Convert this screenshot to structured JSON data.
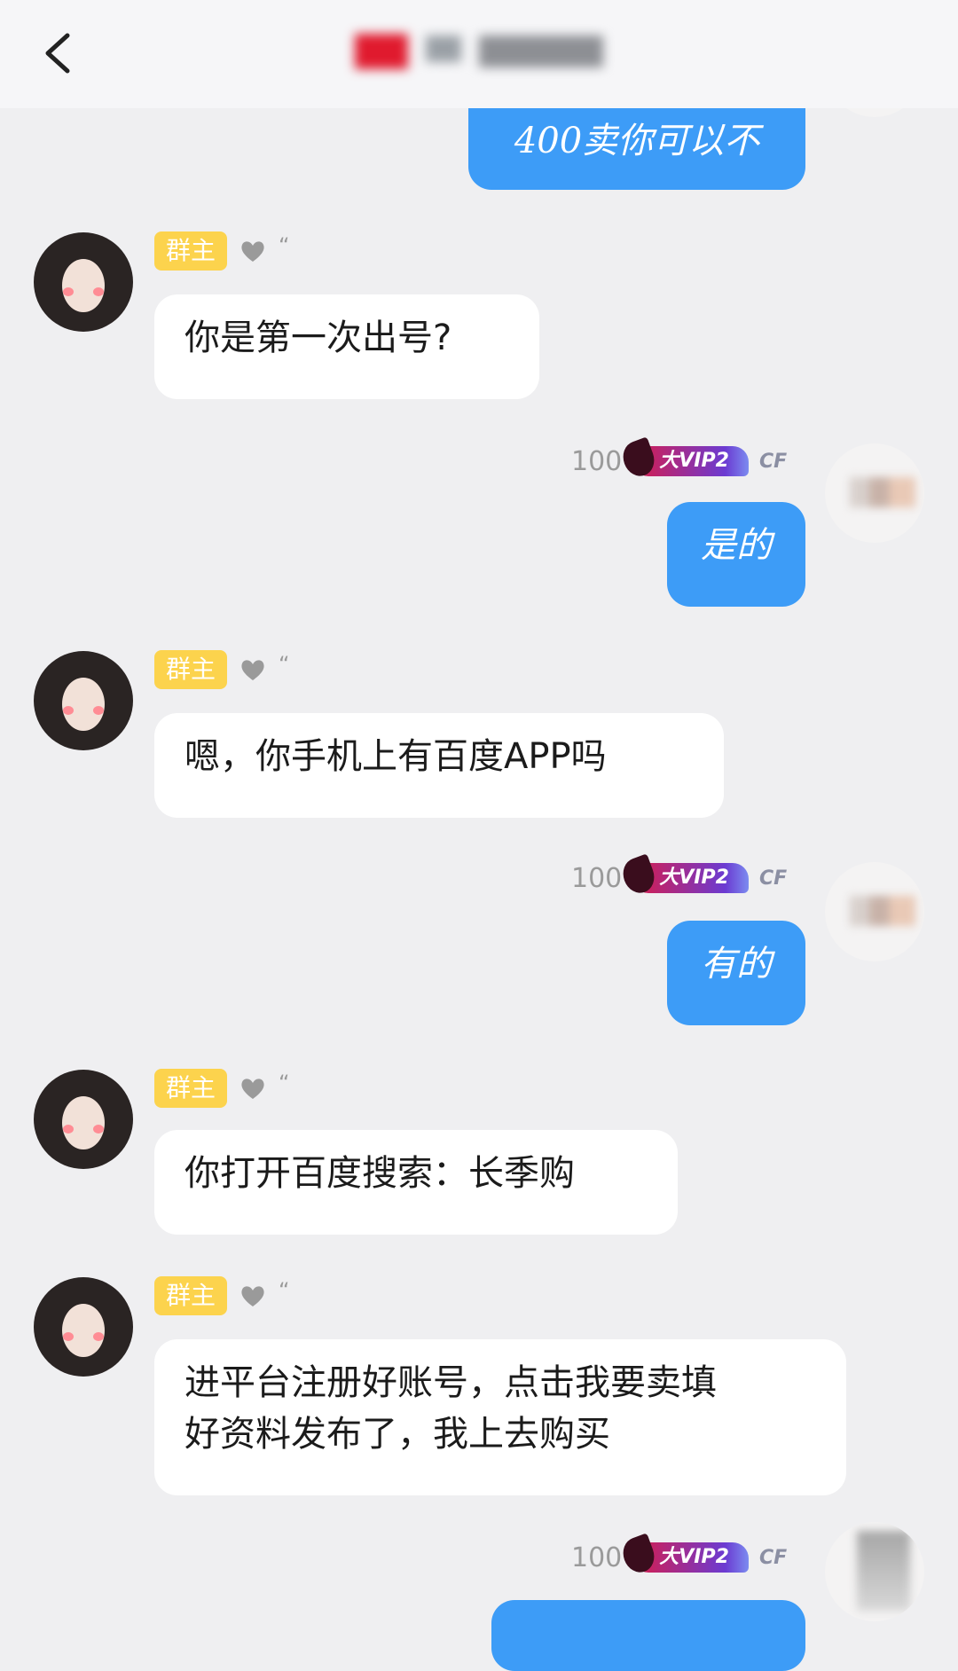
{
  "header": {
    "back_icon": "chevron-left-icon"
  },
  "colors": {
    "my_bubble": "#3d9cf7",
    "owner_badge": "#fcd34d",
    "background": "#efeff1"
  },
  "messages": [
    {
      "side": "me",
      "text": "400卖你可以不"
    },
    {
      "side": "other",
      "badge": "群主",
      "text": "你是第一次出号?"
    },
    {
      "side": "me",
      "level": "100",
      "vip": "VIP2",
      "vip_prefix": "大",
      "text": "是的"
    },
    {
      "side": "other",
      "badge": "群主",
      "text": "嗯，你手机上有百度APP吗"
    },
    {
      "side": "me",
      "level": "100",
      "vip": "VIP2",
      "vip_prefix": "大",
      "text": "有的"
    },
    {
      "side": "other",
      "badge": "群主",
      "text": "你打开百度搜索：长季购"
    },
    {
      "side": "other",
      "badge": "群主",
      "text_line1": "进平台注册好账号，点击我要卖填",
      "text_line2": "好资料发布了，我上去购买"
    },
    {
      "side": "me",
      "level": "100",
      "vip": "VIP2",
      "vip_prefix": "大",
      "text": ""
    }
  ],
  "cf_label": "CF"
}
